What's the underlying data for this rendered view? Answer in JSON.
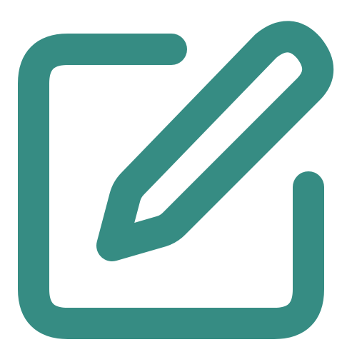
{
  "icon": {
    "name": "edit-icon",
    "stroke_color": "#368c83",
    "background": "#ffffff"
  }
}
